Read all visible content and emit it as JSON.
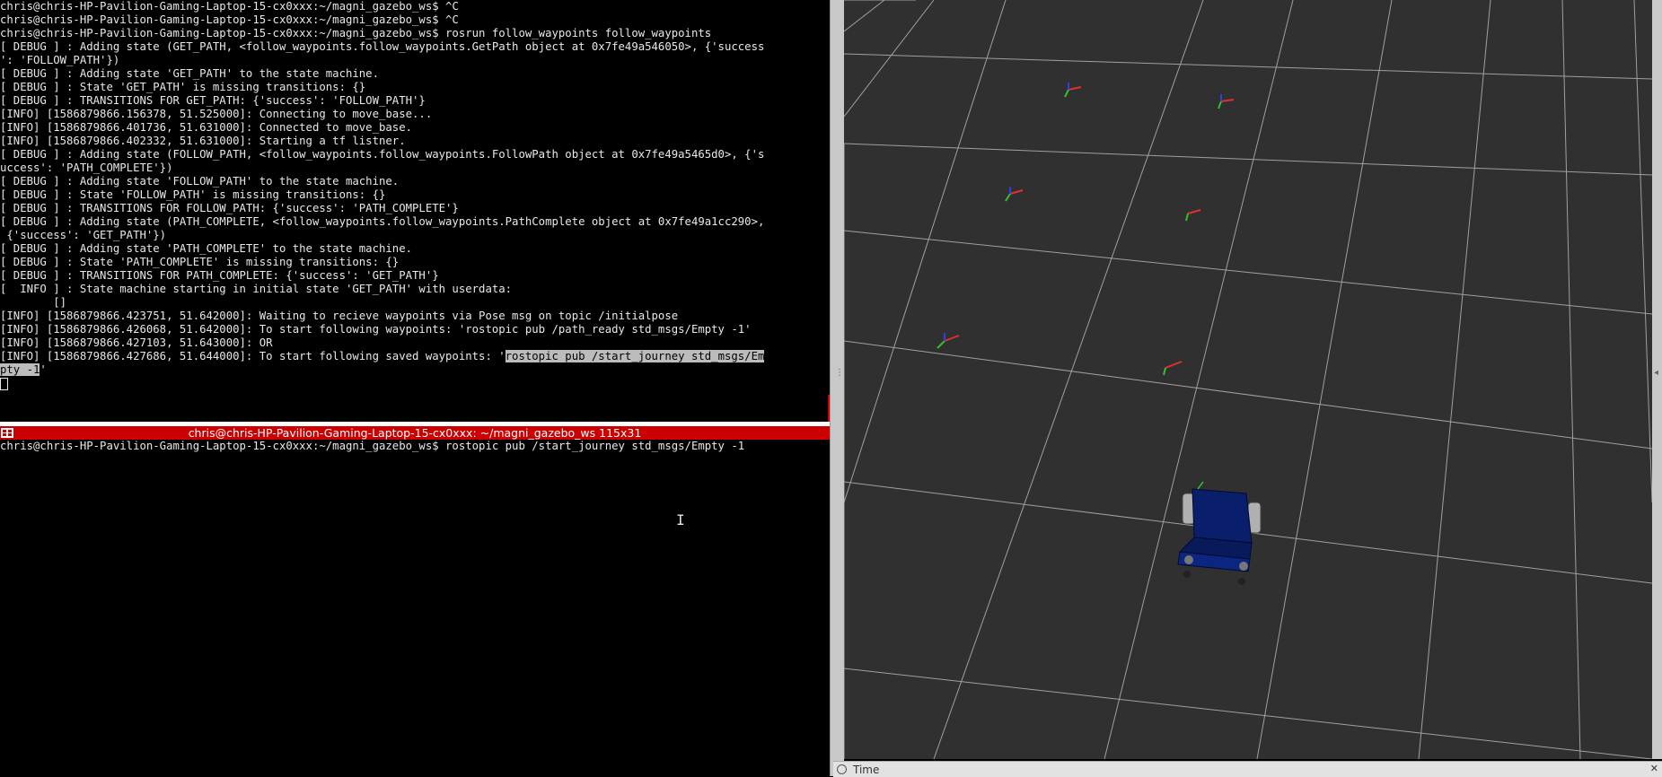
{
  "top_terminal": {
    "lines": [
      "chris@chris-HP-Pavilion-Gaming-Laptop-15-cx0xxx:~/magni_gazebo_ws$ ^C",
      "chris@chris-HP-Pavilion-Gaming-Laptop-15-cx0xxx:~/magni_gazebo_ws$ ^C",
      "chris@chris-HP-Pavilion-Gaming-Laptop-15-cx0xxx:~/magni_gazebo_ws$ rosrun follow_waypoints follow_waypoints",
      "[ DEBUG ] : Adding state (GET_PATH, <follow_waypoints.follow_waypoints.GetPath object at 0x7fe49a546050>, {'success",
      "': 'FOLLOW_PATH'})",
      "[ DEBUG ] : Adding state 'GET_PATH' to the state machine.",
      "[ DEBUG ] : State 'GET_PATH' is missing transitions: {}",
      "[ DEBUG ] : TRANSITIONS FOR GET_PATH: {'success': 'FOLLOW_PATH'}",
      "[INFO] [1586879866.156378, 51.525000]: Connecting to move_base...",
      "[INFO] [1586879866.401736, 51.631000]: Connected to move_base.",
      "[INFO] [1586879866.402332, 51.631000]: Starting a tf listner.",
      "[ DEBUG ] : Adding state (FOLLOW_PATH, <follow_waypoints.follow_waypoints.FollowPath object at 0x7fe49a5465d0>, {'s",
      "uccess': 'PATH_COMPLETE'})",
      "[ DEBUG ] : Adding state 'FOLLOW_PATH' to the state machine.",
      "[ DEBUG ] : State 'FOLLOW_PATH' is missing transitions: {}",
      "[ DEBUG ] : TRANSITIONS FOR FOLLOW_PATH: {'success': 'PATH_COMPLETE'}",
      "[ DEBUG ] : Adding state (PATH_COMPLETE, <follow_waypoints.follow_waypoints.PathComplete object at 0x7fe49a1cc290>,",
      " {'success': 'GET_PATH'})",
      "[ DEBUG ] : Adding state 'PATH_COMPLETE' to the state machine.",
      "[ DEBUG ] : State 'PATH_COMPLETE' is missing transitions: {}",
      "[ DEBUG ] : TRANSITIONS FOR PATH_COMPLETE: {'success': 'GET_PATH'}",
      "[  INFO ] : State machine starting in initial state 'GET_PATH' with userdata:",
      "        []",
      "[INFO] [1586879866.423751, 51.642000]: Waiting to recieve waypoints via Pose msg on topic /initialpose",
      "[INFO] [1586879866.426068, 51.642000]: To start following waypoints: 'rostopic pub /path_ready std_msgs/Empty -1'",
      "[INFO] [1586879866.427103, 51.643000]: OR"
    ],
    "last_line_prefix": "[INFO] [1586879866.427686, 51.644000]: To start following saved waypoints: '",
    "last_line_selected": "rostopic pub /start_journey std_msgs/Em",
    "wrap_selected": "pty -1",
    "wrap_suffix": "'"
  },
  "bottom_terminal": {
    "title": "chris@chris-HP-Pavilion-Gaming-Laptop-15-cx0xxx: ~/magni_gazebo_ws 115x31",
    "lines": [
      "chris@chris-HP-Pavilion-Gaming-Laptop-15-cx0xxx:~/magni_gazebo_ws$ rostopic pub /start_journey std_msgs/Empty -1"
    ]
  },
  "viewport": {
    "background_color": "#303030",
    "grid_color": "#a0a0a0",
    "robot_color": "#0a1f6b",
    "waypoint_count": 6
  },
  "time_panel": {
    "label": "Time",
    "close_glyph": "✕"
  },
  "splitter_glyph": "⋮"
}
